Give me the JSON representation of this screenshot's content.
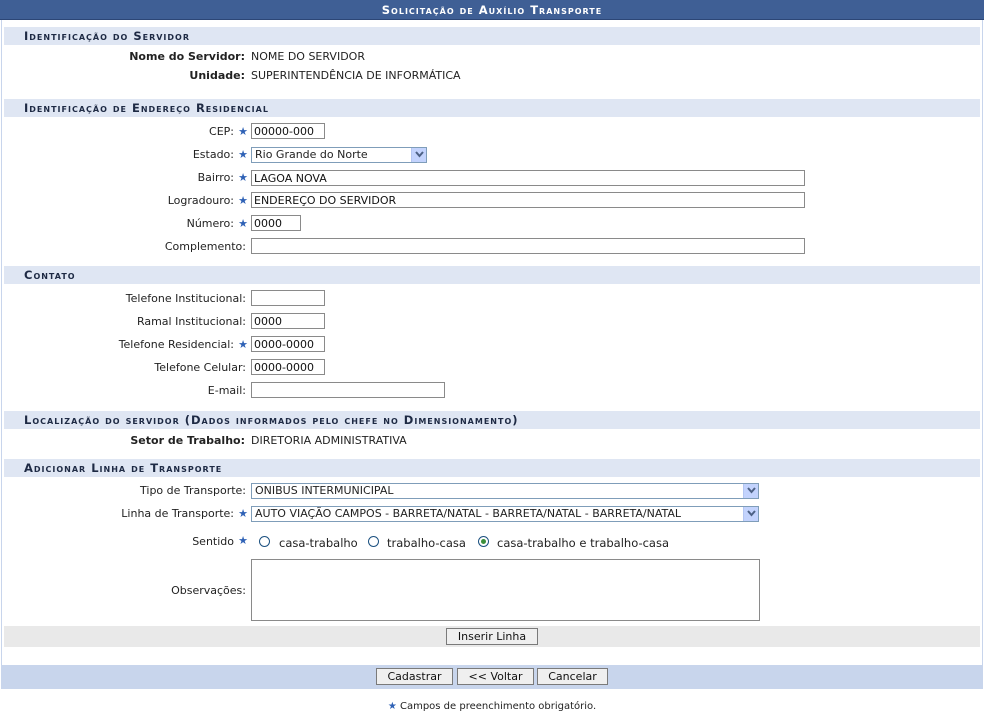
{
  "title": "Solicitação de Auxílio Transporte",
  "sections": {
    "servidor": "Identificação do Servidor",
    "endereco": "Identificação de Endereço Residencial",
    "contato": "Contato",
    "localizacao": "Localização do servidor (Dados informados pelo chefe no Dimensionamento)",
    "linha": "Adicionar Linha de Transporte"
  },
  "servidor": {
    "nome_label": "Nome do Servidor:",
    "nome_value": "NOME DO SERVIDOR",
    "unidade_label": "Unidade:",
    "unidade_value": "SUPERINTENDÊNCIA DE INFORMÁTICA"
  },
  "endereco": {
    "cep_label": "CEP:",
    "cep_value": "00000-000",
    "estado_label": "Estado:",
    "estado_value": "Rio Grande do Norte",
    "bairro_label": "Bairro:",
    "bairro_value": "LAGOA NOVA",
    "logradouro_label": "Logradouro:",
    "logradouro_value": "ENDEREÇO DO SERVIDOR",
    "numero_label": "Número:",
    "numero_value": "0000",
    "complemento_label": "Complemento:",
    "complemento_value": ""
  },
  "contato": {
    "tel_inst_label": "Telefone Institucional:",
    "tel_inst_value": "",
    "ramal_label": "Ramal Institucional:",
    "ramal_value": "0000",
    "tel_res_label": "Telefone Residencial:",
    "tel_res_value": "0000-0000",
    "tel_cel_label": "Telefone Celular:",
    "tel_cel_value": "0000-0000",
    "email_label": "E-mail:",
    "email_value": ""
  },
  "localizacao": {
    "setor_label": "Setor de Trabalho:",
    "setor_value": "DIRETORIA ADMINISTRATIVA"
  },
  "linha": {
    "tipo_label": "Tipo de Transporte:",
    "tipo_value": "ONIBUS INTERMUNICIPAL",
    "linha_label": "Linha de Transporte:",
    "linha_value": "AUTO VIAÇÃO CAMPOS - BARRETA/NATAL - BARRETA/NATAL - BARRETA/NATAL",
    "sentido_label": "Sentido",
    "sentido_options": [
      "casa-trabalho",
      "trabalho-casa",
      "casa-trabalho e trabalho-casa"
    ],
    "sentido_selected": "casa-trabalho e trabalho-casa",
    "observacoes_label": "Observações:",
    "observacoes_value": "",
    "inserir_label": "Inserir Linha"
  },
  "buttons": {
    "cadastrar": "Cadastrar",
    "voltar": "<< Voltar",
    "cancelar": "Cancelar"
  },
  "required_star": "★",
  "footer_note": "Campos de preenchimento obrigatório.",
  "colors": {
    "caption_bg": "#3f5f95",
    "section_bg": "#dfe6f3",
    "required_star": "#2f62b6",
    "footer_bar": "#c8d5ec"
  }
}
